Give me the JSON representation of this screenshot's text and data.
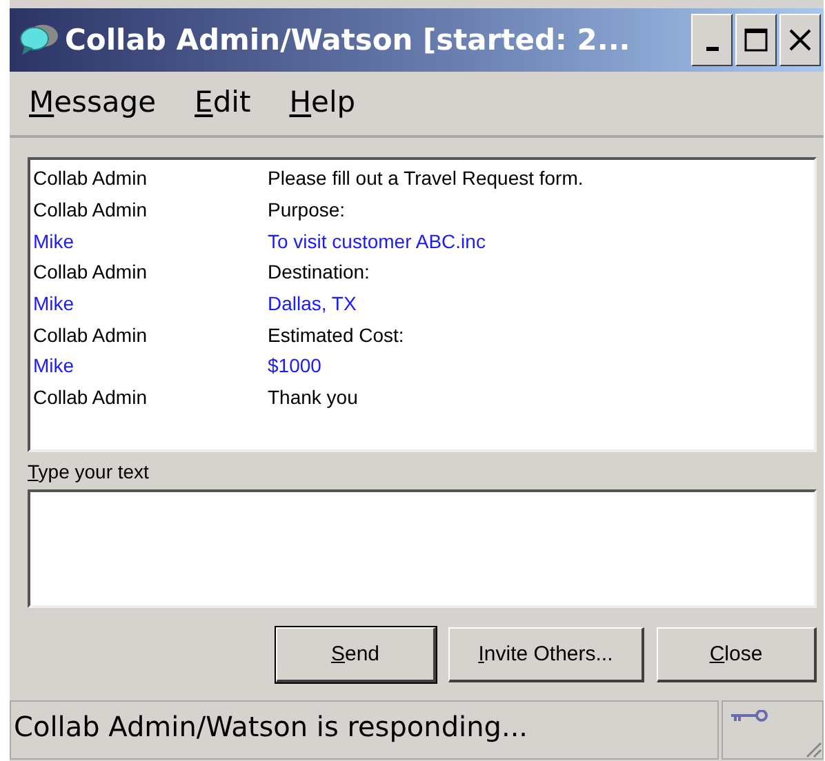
{
  "window": {
    "title": "Collab Admin/Watson [started: 2..."
  },
  "menu": [
    "Message",
    "Edit",
    "Help"
  ],
  "messages": [
    {
      "sender": "Collab Admin",
      "text": "Please fill out a Travel Request form.",
      "color": "#000000"
    },
    {
      "sender": "Collab Admin",
      "text": "Purpose:",
      "color": "#000000"
    },
    {
      "sender": "Mike",
      "text": "To visit customer ABC.inc",
      "color": "#1a1aff"
    },
    {
      "sender": "Collab Admin",
      "text": "Destination:",
      "color": "#000000"
    },
    {
      "sender": "Mike",
      "text": "Dallas, TX",
      "color": "#1a1aff"
    },
    {
      "sender": "Collab Admin",
      "text": "Estimated Cost:",
      "color": "#000000"
    },
    {
      "sender": "Mike",
      "text": "$1000",
      "color": "#1a1aff"
    },
    {
      "sender": "Collab Admin",
      "text": "Thank you",
      "color": "#000000"
    }
  ],
  "input_label": "Type your text",
  "buttons": [
    {
      "label": "Send",
      "default": true
    },
    {
      "label": "Invite Others...",
      "default": false
    },
    {
      "label": "Close",
      "default": false
    }
  ],
  "status_bar": "Collab Admin/Watson is responding..."
}
